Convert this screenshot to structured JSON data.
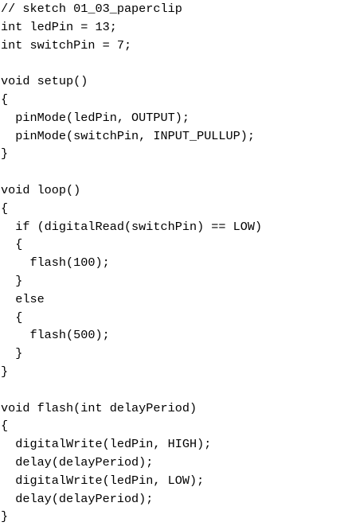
{
  "listing": {
    "lines": [
      "// sketch 01_03_paperclip",
      "int ledPin = 13;",
      "int switchPin = 7;",
      "",
      "void setup()",
      "{",
      "  pinMode(ledPin, OUTPUT);",
      "  pinMode(switchPin, INPUT_PULLUP);",
      "}",
      "",
      "void loop()",
      "{",
      "  if (digitalRead(switchPin) == LOW)",
      "  {",
      "    flash(100);",
      "  }",
      "  else",
      "  {",
      "    flash(500);",
      "  }",
      "}",
      "",
      "void flash(int delayPeriod)",
      "{",
      "  digitalWrite(ledPin, HIGH);",
      "  delay(delayPeriod);",
      "  digitalWrite(ledPin, LOW);",
      "  delay(delayPeriod);",
      "}"
    ]
  }
}
